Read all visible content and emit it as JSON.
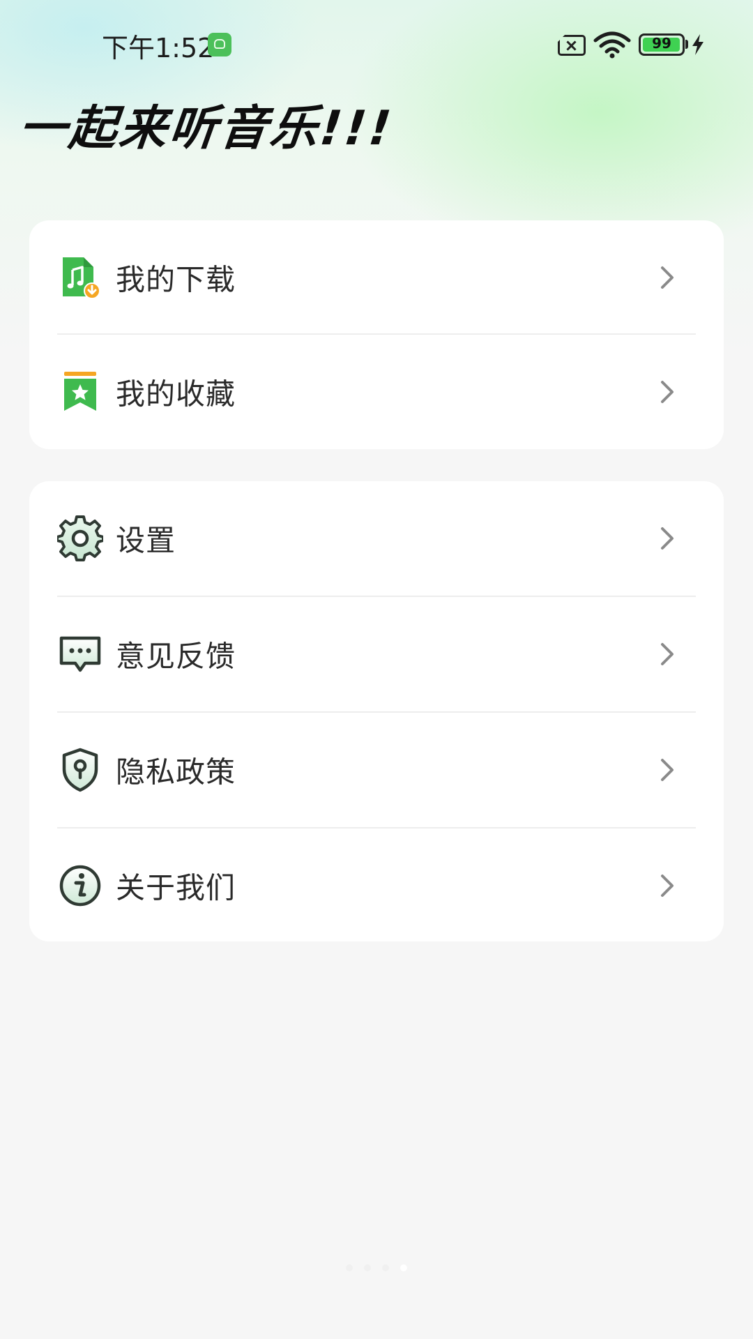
{
  "status_bar": {
    "time": "下午1:52",
    "battery_level": "99",
    "battery_fraction": 0.99
  },
  "header": {
    "title": "一起来听音乐!!!"
  },
  "menu_group_1": {
    "items": [
      {
        "label": "我的下载",
        "icon": "music-download-icon"
      },
      {
        "label": "我的收藏",
        "icon": "bookmark-star-icon"
      }
    ]
  },
  "menu_group_2": {
    "items": [
      {
        "label": "设置",
        "icon": "gear-icon"
      },
      {
        "label": "意见反馈",
        "icon": "feedback-chat-icon"
      },
      {
        "label": "隐私政策",
        "icon": "shield-lock-icon"
      },
      {
        "label": "关于我们",
        "icon": "info-icon"
      }
    ]
  },
  "colors": {
    "accent_green": "#3fba4e",
    "accent_orange": "#f5a623",
    "text_primary": "#2a2a2a",
    "chevron": "#8a8a8a"
  }
}
